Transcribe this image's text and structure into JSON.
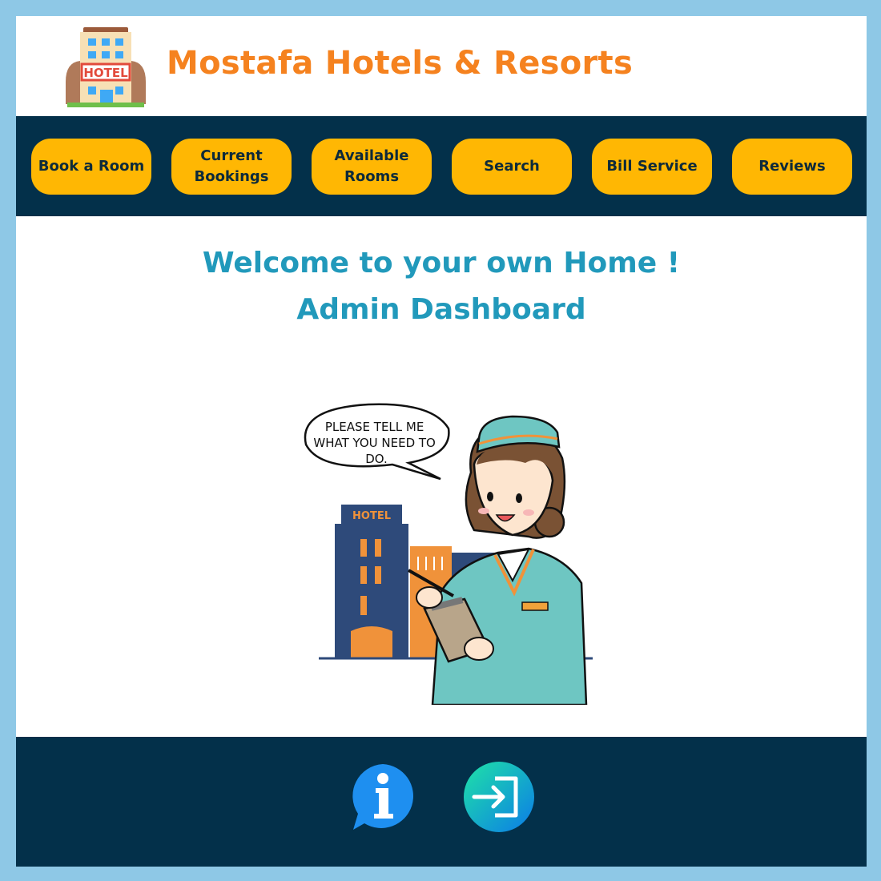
{
  "header": {
    "brand_name": "Mostafa Hotels & Resorts",
    "logo_sign": "HOTEL",
    "brand_color": "#f5821f"
  },
  "nav": {
    "items": [
      {
        "label": "Book a Room"
      },
      {
        "label": "Current Bookings"
      },
      {
        "label": "Available Rooms"
      },
      {
        "label": "Search"
      },
      {
        "label": "Bill Service"
      },
      {
        "label": "Reviews"
      }
    ],
    "button_color": "#ffb703",
    "bar_color": "#03304a"
  },
  "main": {
    "welcome": "Welcome to your own Home !",
    "subtitle": "Admin Dashboard",
    "title_color": "#2199bb",
    "illustration": {
      "speech": [
        "PLEASE TELL ME",
        "WHAT YOU NEED TO",
        "DO."
      ],
      "building_sign": "HOTEL"
    }
  },
  "footer": {
    "icons": [
      {
        "name": "info-icon"
      },
      {
        "name": "logout-icon"
      }
    ]
  }
}
